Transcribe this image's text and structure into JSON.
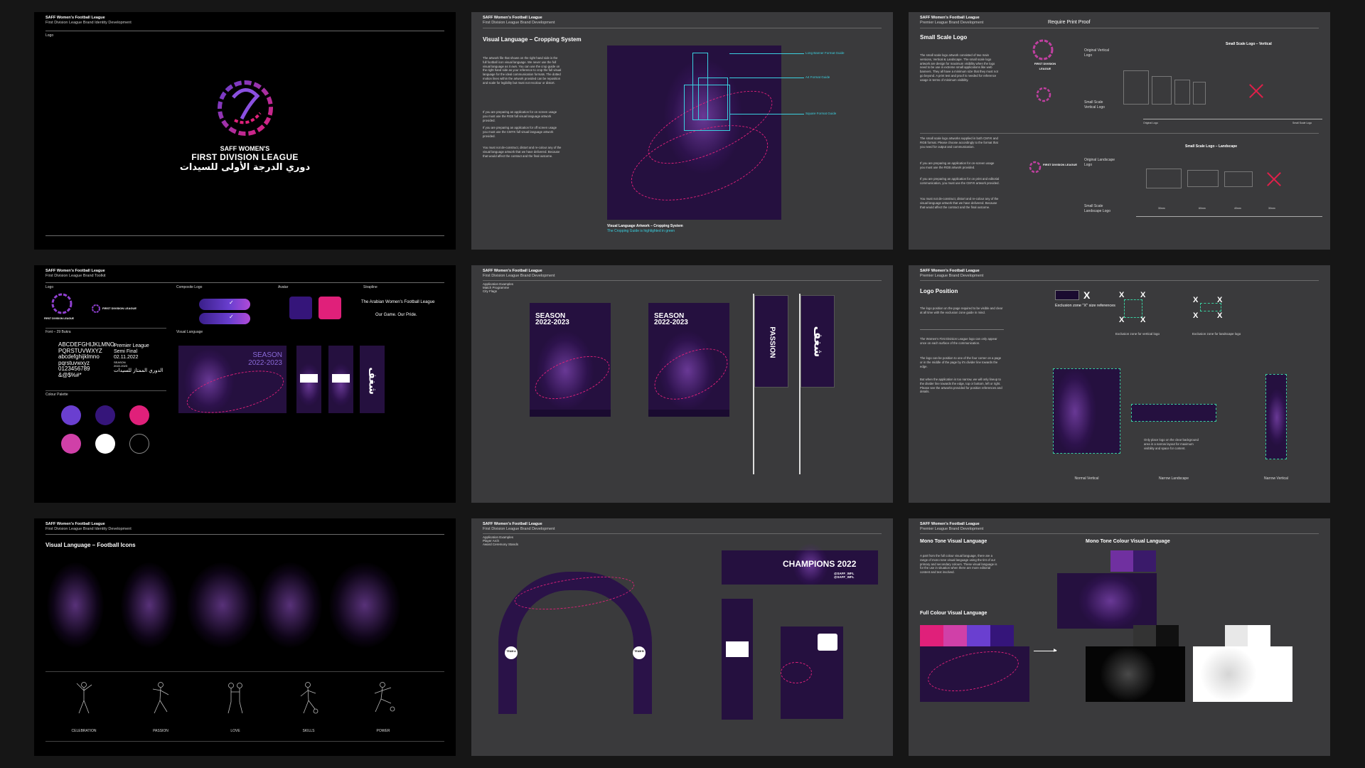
{
  "slides": {
    "s1": {
      "org": "SAFF Women's Football League",
      "sub": "First Division League Brand Identity Development",
      "section": "Logo",
      "logo_top": "SAFF WOMEN'S",
      "logo_main": "FIRST DIVISION LEAGUE",
      "logo_ar": "دوري الدرجة الأولى للسيدات"
    },
    "s2": {
      "org": "SAFF Women's Football League",
      "sub": "First Division League Brand Development",
      "title": "Visual Language – Cropping System",
      "p1": "The artwork file that shown on the right hand side is the full football icon visual language. We never use the full visual language as it own. You can use the crop guide on the right hand side as your reference to crop the full visual language for the ideal communication formats. The dotted motion lines within the artwork provided can be reposition and scale for legibility but must not recolour or distort.",
      "p2": "If you are preparing an application for on screen usage you must use the RGB full visual language artwork provided.",
      "p3": "If you are preparing an application for off screen usage you must use the CMYK full visual language artwork provided.",
      "p4": "You must not de-construct, distort and re-colour any of the visual language artwork that we have delivered. Because that would affect the contract and the final outcome.",
      "guide1": "Long Banner Format Guide",
      "guide2": "A4 Format Guide",
      "guide3": "Square Format Guide",
      "cap1": "Visual Language Artwork – Cropping System",
      "cap2": "The Cropping Guide is highlighted in green"
    },
    "s3": {
      "org": "SAFF Women's Football League",
      "sub": "Premier League Brand Development",
      "title": "Small Scale Logo",
      "proof": "Require Print Proof",
      "p1": "The small scale logo artwork consisted of two main versions, Vertical & Landscape. The small scale logo artwork are design for maximum visibility when the logo need to be use in extreme small applications like web banners. They all have a minimum size that they must not go beyond. A print test and proof is needed for reference usage in terms of minimum visibility.",
      "p2": "The small scale logo artworks supplied in both CMYK and RGB format. Please choose accordingly to the format that you need for output and communication.",
      "p3": "If you are preparing an application for on-screen usage you must use the RGB artwork provided.",
      "p4": "If you are preparing an application for on print and editorial communication, you must use the CMYK artwork provided.",
      "p5": "You must not de-construct, distort and re-colour any of the visual language artwork that we have delivered. Because that would affect the contract and the final outcome.",
      "orig_v": "Original Vertical Logo",
      "small_v": "Small Scale Vertical Logo",
      "orig_l": "Original Landscape Logo",
      "small_l": "Small Scale Landscape Logo",
      "sv_title": "Small Scale Logo – Vertical",
      "sl_title": "Small Scale Logo – Landscape",
      "mm": [
        "30mm",
        "60mm",
        "40mm",
        "30mm"
      ],
      "orig_logo": "Original Logo",
      "small_logo": "Small Scale Logo"
    },
    "s4": {
      "org": "SAFF Women's Football League",
      "sub": "First Division League Brand Toolkit",
      "logo": "Logo",
      "composite": "Composite Logo",
      "avatar": "Avatar",
      "strapline": "Strapline",
      "strap1": "The Arabian Women's Football League",
      "strap2": "Our Game. Our Pride.",
      "font_lbl": "Font – 29 Bukra",
      "f1": "ABCDEFGHIJKLMNO",
      "f2": "PQRSTUVWXYZ",
      "f3": "abcdefghijklmno",
      "f4": "pqrstuvwxyz",
      "f5": "0123456789",
      "f6": "&@$%#*",
      "f_r1": "Premier League",
      "f_r2": "Semi Final",
      "f_r3": "02.11.2022",
      "f_r4": "SEASON",
      "f_r5": "2022-2023",
      "f_ar": "الدوري الممتاز للسيدات",
      "vl": "Visual Language",
      "season1": "SEASON",
      "season2": "2022-2023",
      "palette": "Colour Palette",
      "ar_banner": "شغف"
    },
    "s5": {
      "org": "SAFF Women's Football League",
      "sub": "First Division League Brand Development",
      "l1": "Application Examples",
      "l2": "Match Programme",
      "l3": "City Flags",
      "season": "SEASON",
      "years": "2022-2023",
      "flag1": "PASSION",
      "flag2": "شغف"
    },
    "s6": {
      "org": "SAFF Women's Football League",
      "sub": "Premier League Brand Development",
      "title": "Logo Position",
      "excl": "Exclusion zone \"X\" size references",
      "excl_v": "Exclusion zone for vertical logo",
      "excl_l": "Exclusion zone for landscape logo",
      "p1": "The logo position on the page required to be visible and clear at all time with the exclusion zone guide in mind.",
      "p2": "The Women's First Division League logo can only appear once on each surface of the communication.",
      "p3": "The logo can be position to one of the four corner on a page or in the middle of the page by it's divider line towards the edge.",
      "p4": "But when the application is too narrow, we will only lineup to the divider line towards the edge, top or bottom, left or right. Please see the artworks provided for position references and details.",
      "note": "Only place logo on the clear background area in a narrow layout for maximum visibility and space for content.",
      "nv": "Normal Vertical",
      "nl": "Narrow Landscape",
      "nrv": "Narrow Vertical"
    },
    "s7": {
      "org": "SAFF Women's Football League",
      "sub": "First Division League Brand Identity Development",
      "title": "Visual Language – Football Icons",
      "icons": [
        "CELEBRATION",
        "PASSION",
        "LOVE",
        "SKILLS",
        "POWER"
      ]
    },
    "s8": {
      "org": "SAFF Women's Football League",
      "sub": "First Division League Brand Development",
      "l1": "Application Examples",
      "l2": "Player Arch",
      "l3": "Award Ceremony Stands",
      "champ": "CHAMPIONS 2022",
      "teamA": "TEAM A",
      "teamB": "TEAM B",
      "handle1": "@SAFF_WFL",
      "handle2": "@SAFF_WFL"
    },
    "s9": {
      "org": "SAFF Women's Football League",
      "sub": "Premier League Brand Development",
      "title": "Mono Tone Visual Language",
      "title2": "Mono Tone Colour Visual Language",
      "full": "Full Colour Visual Language",
      "p1": "A part from the full colour visual language, there are a range of mono tone visual language using the tint of our primary and secondary colours. These visual language is for the use in situation when there are more editorial content and text involved."
    }
  },
  "colors": {
    "magenta": "#e0207a",
    "purple_deep": "#25103f",
    "violet": "#6a3fd0",
    "slide_grey": "#3a3a3c"
  }
}
